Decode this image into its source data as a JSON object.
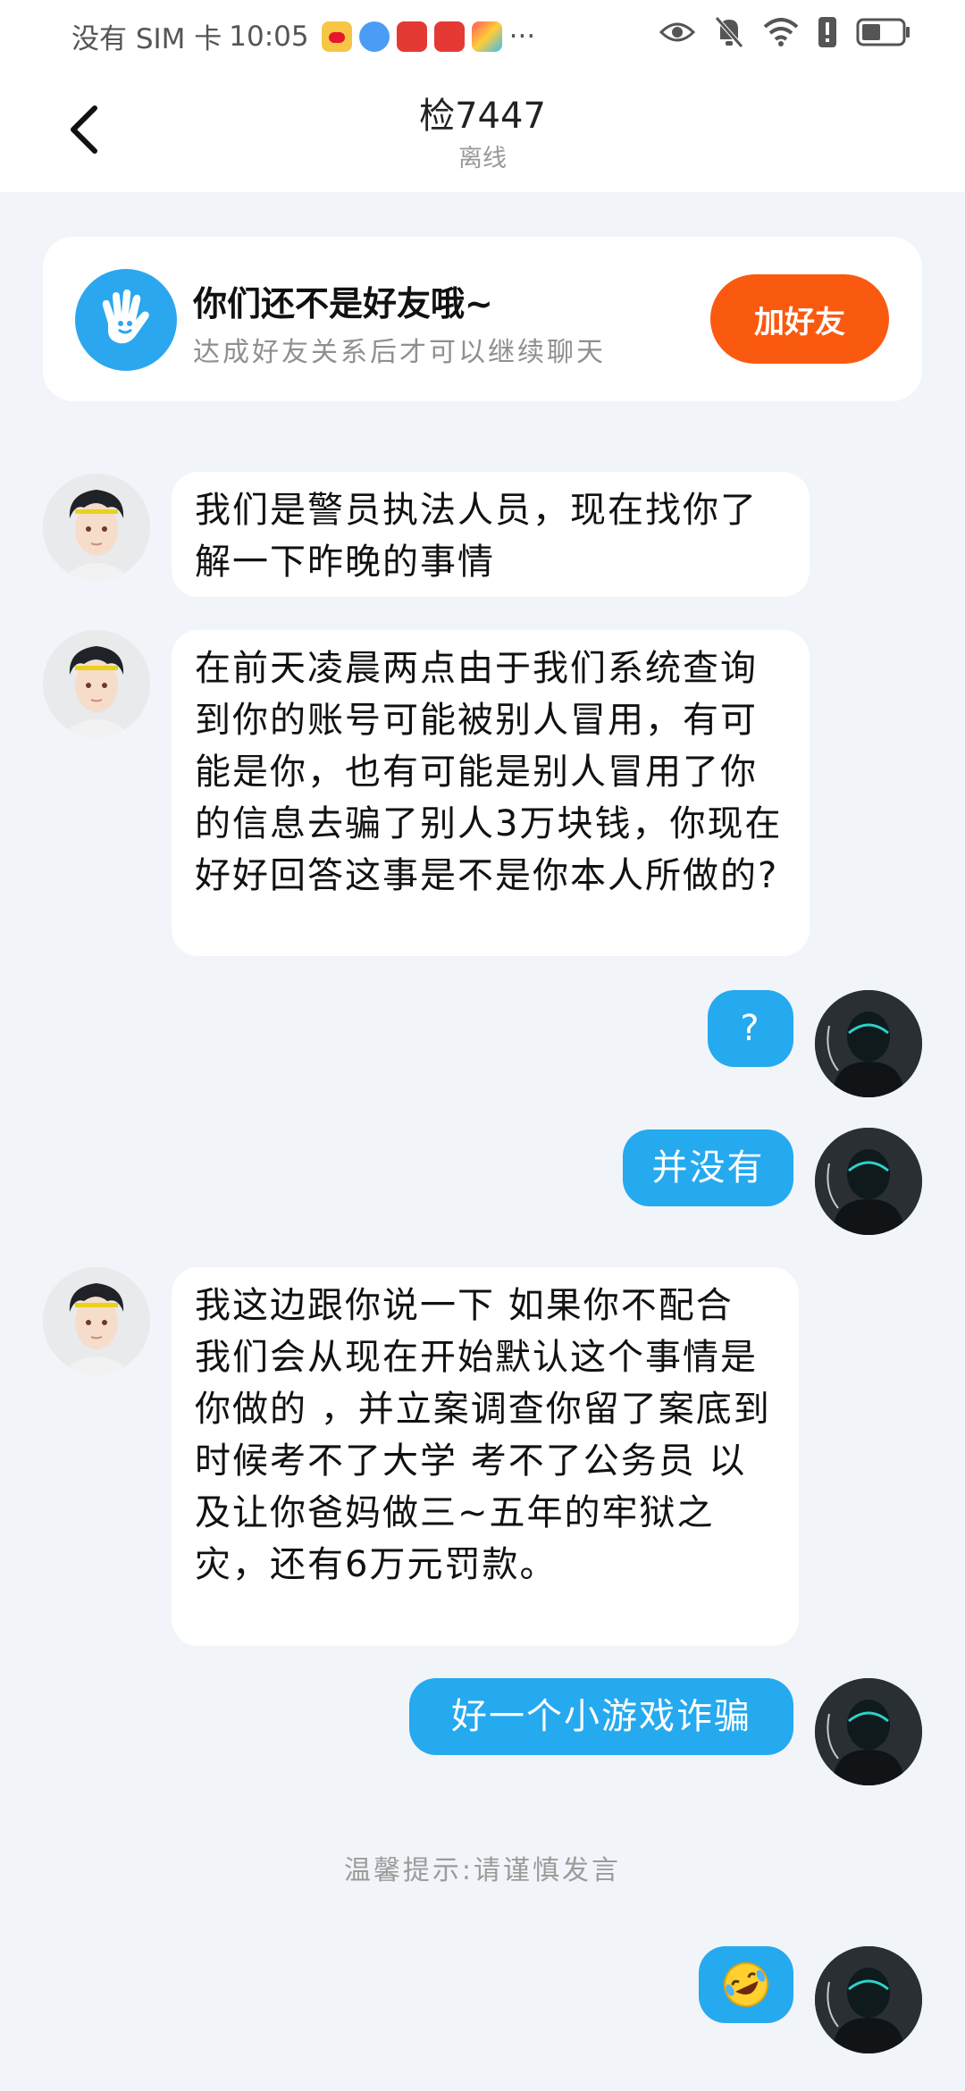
{
  "status_bar": {
    "carrier": "没有 SIM 卡",
    "time": "10:05",
    "more": "···",
    "app_icons": [
      "weibo-icon",
      "browser-icon",
      "red-app-icon",
      "red-app-icon-2",
      "colorful-app-icon"
    ],
    "right_icons": [
      "eye-icon",
      "mute-icon",
      "wifi-icon",
      "alert-icon",
      "battery-icon"
    ]
  },
  "header": {
    "back_icon": "chevron-left-icon",
    "title": "检7447",
    "subtitle": "离线"
  },
  "friend_card": {
    "icon": "hand-wave-icon",
    "title": "你们还不是好友哦~",
    "subtitle": "达成好友关系后才可以继续聊天",
    "button": "加好友",
    "button_color": "#fa5a0f"
  },
  "messages": [
    {
      "side": "left",
      "text": "我们是警员执法人员，现在找你了解一下昨晚的事情"
    },
    {
      "side": "left",
      "text": "在前天凌晨两点由于我们系统查询到你的账号可能被别人冒用，有可能是你，也有可能是别人冒用了你的信息去骗了别人3万块钱，你现在好好回答这事是不是你本人所做的?"
    },
    {
      "side": "right",
      "text": "?"
    },
    {
      "side": "right",
      "text": "并没有"
    },
    {
      "side": "left",
      "text": "我这边跟你说一下 如果你不配合 我们会从现在开始默认这个事情是你做的 ，并立案调查你留了案底到时候考不了大学 考不了公务员 以及让你爸妈做三~五年的牢狱之灾，还有6万元罚款。"
    },
    {
      "side": "right",
      "text": "好一个小游戏诈骗"
    },
    {
      "side": "right",
      "emoji": "laughing-crying-emoji"
    }
  ],
  "hint": "温馨提示:请谨慎发言",
  "colors": {
    "background": "#f1f4f8",
    "outgoing_bubble": "#25a9ef",
    "incoming_bubble": "#ffffff"
  }
}
